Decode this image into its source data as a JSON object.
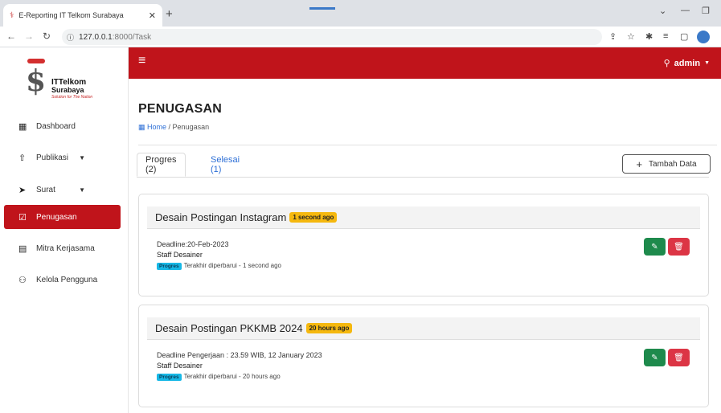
{
  "browser": {
    "tab_title": "E-Reporting IT Telkom Surabaya",
    "tab_close": "✕",
    "new_tab": "+",
    "url_host": "127.0.0.1",
    "url_path": ":8000/Task",
    "icons": [
      "back-icon",
      "forward-icon",
      "reload-icon",
      "info-icon",
      "share-icon",
      "star-icon",
      "extensions-icon",
      "media-icon",
      "sidepanel-icon",
      "profile-icon"
    ]
  },
  "sidebar": {
    "logo": {
      "line1": "ITTelkom",
      "line2": "Surabaya",
      "line3": "Solution for The Nation"
    },
    "items": [
      {
        "label": "Dashboard",
        "icon": "grid-icon"
      },
      {
        "label": "Publikasi",
        "icon": "upload-icon",
        "has_chevron": true
      },
      {
        "label": "Surat",
        "icon": "send-icon",
        "has_chevron": true
      },
      {
        "label": "Penugasan",
        "icon": "check-square-icon",
        "active": true
      },
      {
        "label": "Mitra Kerjasama",
        "icon": "id-card-icon"
      },
      {
        "label": "Kelola Pengguna",
        "icon": "users-icon"
      }
    ]
  },
  "header": {
    "user": "admin"
  },
  "page": {
    "title": "PENUGASAN",
    "breadcrumb_home": "Home",
    "breadcrumb_current": " / Penugasan"
  },
  "tabs": [
    {
      "label": "Progres (2)",
      "active": true
    },
    {
      "label": "Selesai (1)",
      "active": false
    }
  ],
  "add_button": "Tambah Data",
  "tasks": [
    {
      "title": "Desain Postingan Instagram",
      "time_badge": "1 second ago",
      "deadline": "Deadline:20-Feb-2023",
      "staff": "Staff Desainer",
      "status": "Progres",
      "updated": "Terakhir diperbarui - 1 second ago"
    },
    {
      "title": "Desain Postingan PKKMB 2024",
      "time_badge": "20 hours ago",
      "deadline": "Deadline Pengerjaan : 23.59 WIB, 12 January 2023",
      "staff": "Staff Desainer",
      "status": "Progres",
      "updated": "Terakhir diperbarui - 20 hours ago"
    }
  ],
  "colors": {
    "brand_red": "#c0141b",
    "edit_green": "#1e8a4c",
    "delete_red": "#dc3545",
    "badge_yellow": "#f5b80e",
    "progress_cyan": "#17b8e6"
  }
}
